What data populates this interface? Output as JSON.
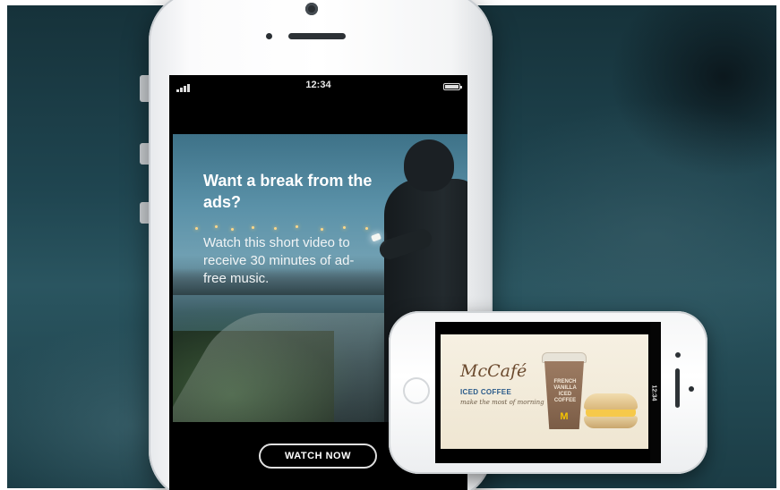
{
  "status_bar": {
    "time": "12:34"
  },
  "ad": {
    "headline": "Want a break from the ads?",
    "body": "Watch this short video to receive 30 minutes of ad-free music.",
    "button_label": "WATCH NOW"
  },
  "video_ad": {
    "brand": "McCafé",
    "product": "ICED COFFEE",
    "tagline": "make the most of morning",
    "cup_label": "FRENCH VANILLA ICED COFFEE",
    "logo_letter": "M"
  }
}
